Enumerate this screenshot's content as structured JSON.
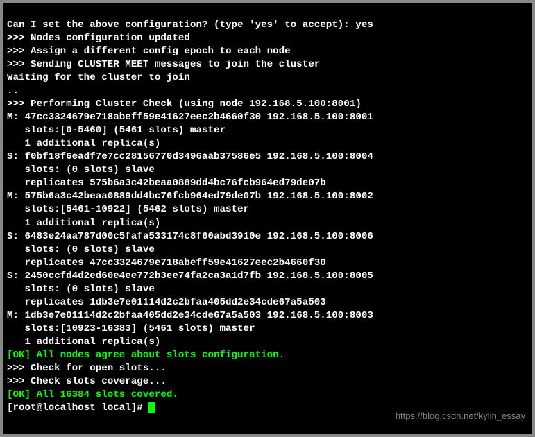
{
  "prompt_question": "Can I set the above configuration? (type 'yes' to accept): ",
  "prompt_answer": "yes",
  "header_nodes_updated": ">>> Nodes configuration updated",
  "header_assign_epoch": ">>> Assign a different config epoch to each node",
  "header_sending_meet": ">>> Sending CLUSTER MEET messages to join the cluster",
  "waiting_line": "Waiting for the cluster to join",
  "dots_line": "..",
  "header_cluster_check": ">>> Performing Cluster Check (using node 192.168.5.100:8001)",
  "nodes": [
    {
      "role": "M",
      "id": "47cc3324679e718abeff59e41627eec2b4660f30",
      "addr": "192.168.5.100:8001",
      "slots": "slots:[0-5460] (5461 slots) master",
      "extra": "1 additional replica(s)"
    },
    {
      "role": "S",
      "id": "f0bf18f6eadf7e7cc28156770d3496aab37586e5",
      "addr": "192.168.5.100:8004",
      "slots": "slots: (0 slots) slave",
      "extra": "replicates 575b6a3c42beaa0889dd4bc76fcb964ed79de07b"
    },
    {
      "role": "M",
      "id": "575b6a3c42beaa0889dd4bc76fcb964ed79de07b",
      "addr": "192.168.5.100:8002",
      "slots": "slots:[5461-10922] (5462 slots) master",
      "extra": "1 additional replica(s)"
    },
    {
      "role": "S",
      "id": "6483e24aa787d00c5fafa533174c8f60abd3910e",
      "addr": "192.168.5.100:8006",
      "slots": "slots: (0 slots) slave",
      "extra": "replicates 47cc3324679e718abeff59e41627eec2b4660f30"
    },
    {
      "role": "S",
      "id": "2450ccfd4d2ed60e4ee772b3ee74fa2ca3a1d7fb",
      "addr": "192.168.5.100:8005",
      "slots": "slots: (0 slots) slave",
      "extra": "replicates 1db3e7e01114d2c2bfaa405dd2e34cde67a5a503"
    },
    {
      "role": "M",
      "id": "1db3e7e01114d2c2bfaa405dd2e34cde67a5a503",
      "addr": "192.168.5.100:8003",
      "slots": "slots:[10923-16383] (5461 slots) master",
      "extra": "1 additional replica(s)"
    }
  ],
  "ok_slots_agree": "[OK] All nodes agree about slots configuration.",
  "check_open_slots": ">>> Check for open slots...",
  "check_slots_coverage": ">>> Check slots coverage...",
  "ok_slots_covered": "[OK] All 16384 slots covered.",
  "shell_prompt": "[root@localhost local]# ",
  "watermark": "https://blog.csdn.net/kylin_essay"
}
